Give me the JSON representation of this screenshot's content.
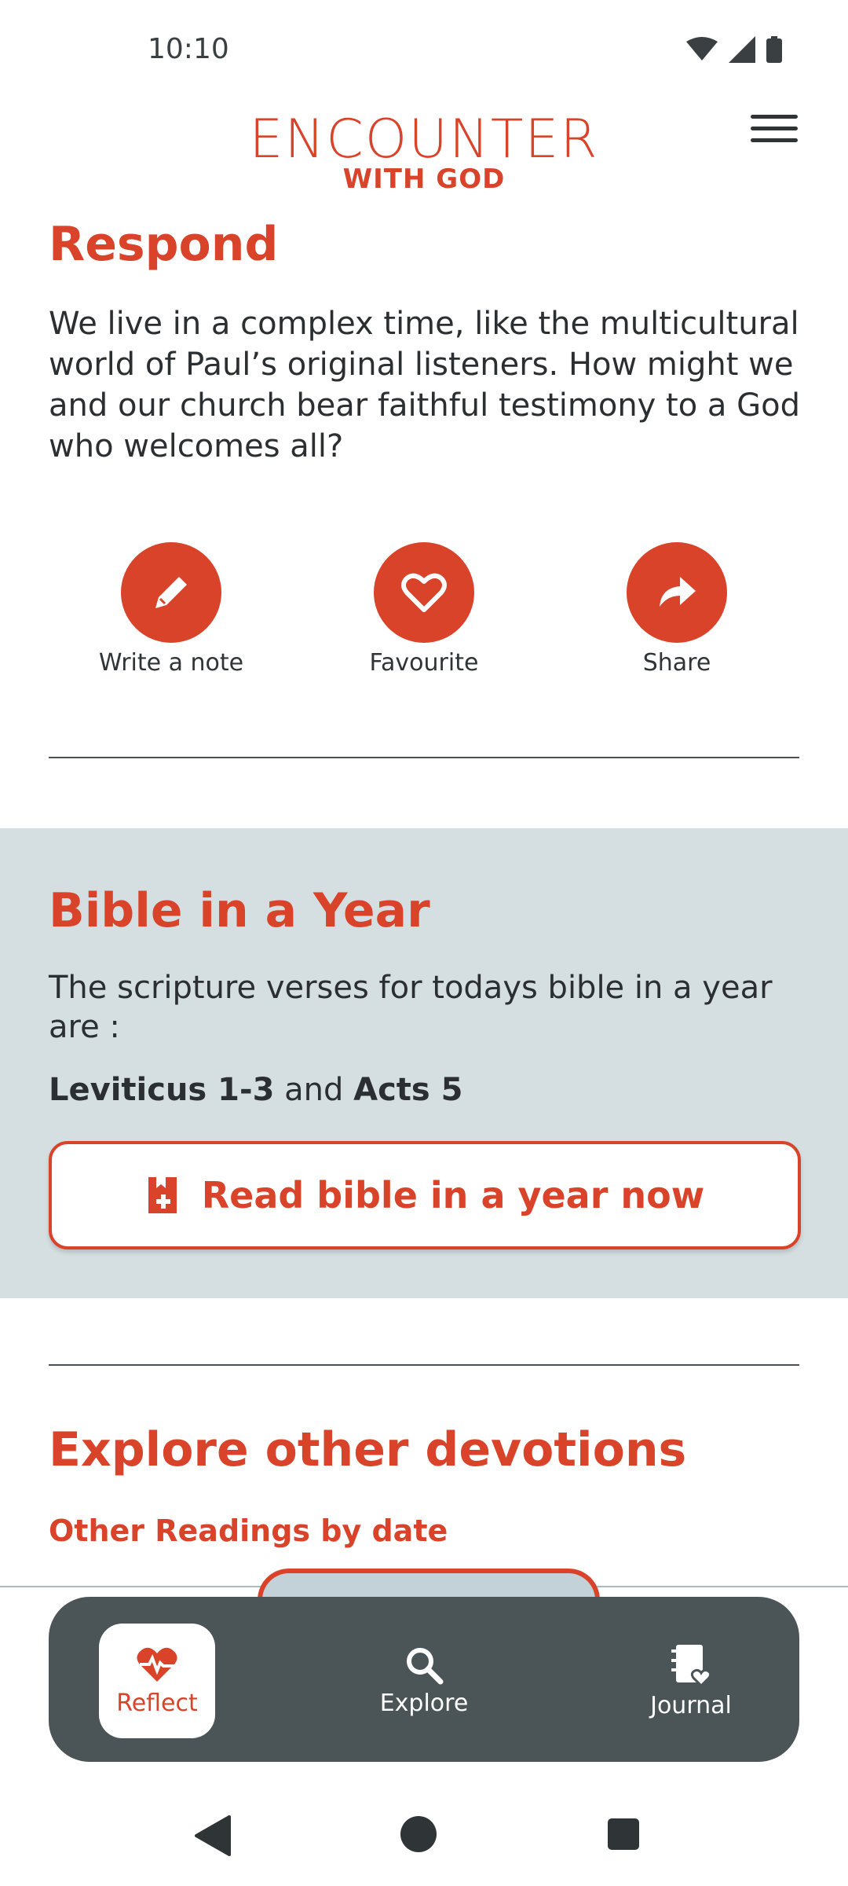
{
  "status_bar": {
    "time": "10:10"
  },
  "header": {
    "logo_main": "ENCOUNTER",
    "logo_sub": "WITH GOD"
  },
  "respond": {
    "title": "Respond",
    "text": "We live in a complex time, like the multicultural world of Paul’s original listeners. How might we and our church bear faithful testimony to a God who welcomes all?",
    "actions": [
      {
        "label": "Write a note",
        "icon": "pencil-icon"
      },
      {
        "label": "Favourite",
        "icon": "heart-icon"
      },
      {
        "label": "Share",
        "icon": "share-icon"
      }
    ]
  },
  "bible_in_a_year": {
    "title": "Bible in a Year",
    "text": "The scripture verses for todays bible in a year are :",
    "ref1": "Leviticus 1-3",
    "conj": "and",
    "ref2": "Acts 5",
    "button_label": "Read bible in a year now"
  },
  "explore": {
    "title": "Explore other devotions",
    "subtitle": "Other Readings by date"
  },
  "bottom_nav": {
    "items": [
      {
        "label": "Reflect",
        "icon": "heart-pulse-icon",
        "active": true
      },
      {
        "label": "Explore",
        "icon": "search-icon",
        "active": false
      },
      {
        "label": "Journal",
        "icon": "journal-icon",
        "active": false
      }
    ]
  },
  "colors": {
    "accent": "#d9432a",
    "panel_bg": "#d5dfe2",
    "nav_bg": "#4b5456"
  }
}
